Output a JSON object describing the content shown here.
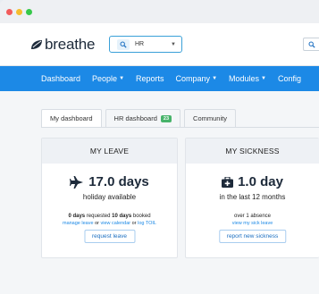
{
  "header": {
    "logo_text": "breathe",
    "search": {
      "value": "HR"
    }
  },
  "nav": {
    "items": [
      {
        "label": "Dashboard",
        "dropdown": false
      },
      {
        "label": "People",
        "dropdown": true
      },
      {
        "label": "Reports",
        "dropdown": false
      },
      {
        "label": "Company",
        "dropdown": true
      },
      {
        "label": "Modules",
        "dropdown": true
      },
      {
        "label": "Config",
        "dropdown": false
      }
    ]
  },
  "tabs": {
    "my_dashboard": "My dashboard",
    "hr_dashboard": "HR dashboard",
    "hr_badge": "23",
    "community": "Community"
  },
  "leave": {
    "title": "MY LEAVE",
    "amount": "17.0 days",
    "subtitle": "holiday available",
    "requested_value": "0 days",
    "requested_text": "requested",
    "booked_value": "10 days",
    "booked_text": "booked",
    "link_manage": "manage leave",
    "or1": "or",
    "link_calendar": "view calendar",
    "or2": "or",
    "link_toil": "log TOIL",
    "button": "request leave"
  },
  "sickness": {
    "title": "MY SICKNESS",
    "amount": "1.0 day",
    "subtitle": "in the last 12 months",
    "detail": "over 1 absence",
    "link_view": "view my sick leave",
    "button": "report new sickness"
  },
  "colors": {
    "nav_blue": "#1c89e6",
    "badge_green": "#47b36a",
    "link_blue": "#1c89e6"
  }
}
